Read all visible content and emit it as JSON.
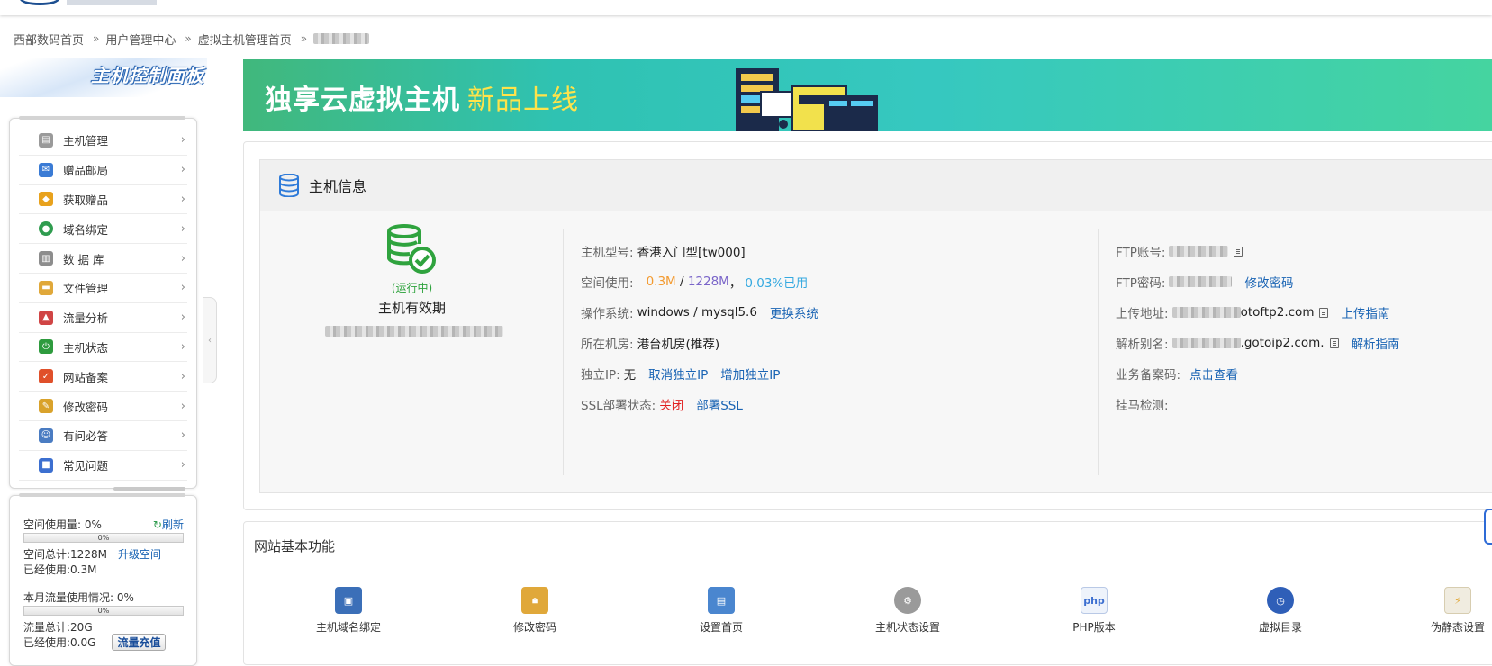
{
  "breadcrumb": {
    "items": [
      "西部数码首页",
      "用户管理中心",
      "虚拟主机管理首页"
    ],
    "separator": "»"
  },
  "sidebar": {
    "panel_title": "主机控制面板",
    "items": [
      {
        "label": "主机管理",
        "icon": "server-icon",
        "color": "#8a8a8a"
      },
      {
        "label": "赠品邮局",
        "icon": "mail-icon",
        "color": "#3a7bd5"
      },
      {
        "label": "获取赠品",
        "icon": "gift-icon",
        "color": "#e8a21d"
      },
      {
        "label": "域名绑定",
        "icon": "globe-icon",
        "color": "#2f9c4f"
      },
      {
        "label": "数 据 库",
        "icon": "database-icon",
        "color": "#7d7d7d"
      },
      {
        "label": "文件管理",
        "icon": "folder-icon",
        "color": "#e0a83a"
      },
      {
        "label": "流量分析",
        "icon": "chart-icon",
        "color": "#d04545"
      },
      {
        "label": "主机状态",
        "icon": "power-icon",
        "color": "#2e9b3e"
      },
      {
        "label": "网站备案",
        "icon": "record-icon",
        "color": "#e0502a"
      },
      {
        "label": "修改密码",
        "icon": "key-icon",
        "color": "#d9a22b"
      },
      {
        "label": "有问必答",
        "icon": "support-icon",
        "color": "#4a7cc2"
      },
      {
        "label": "常见问题",
        "icon": "faq-icon",
        "color": "#3c6fd0"
      }
    ],
    "chevron": "›"
  },
  "usage": {
    "space_used_label": "空间使用量: 0%",
    "refresh": "刷新",
    "space_bar_text": "0%",
    "space_total": "空间总计:1228M",
    "upgrade": "升级空间",
    "space_used": "已经使用:0.3M",
    "traffic_label": "本月流量使用情况: 0%",
    "traffic_bar_text": "0%",
    "traffic_total": "流量总计:20G",
    "traffic_used": "已经使用:0.0G",
    "recharge": "流量充值",
    "space_percent": 0,
    "traffic_percent": 0
  },
  "banner": {
    "title": "独享云虚拟主机",
    "subtitle": "新品上线"
  },
  "info": {
    "title": "主机信息",
    "status": "(运行中)",
    "validity_label": "主机有效期",
    "model_label": "主机型号:",
    "model_value": "香港入门型[tw000]",
    "space_label": "空间使用:",
    "space_used": "0.3M",
    "space_sep": " / ",
    "space_total": "1228M",
    "space_comma": "，",
    "space_percent": "0.03%已用",
    "os_label": "操作系统:",
    "os_value": "windows / mysql5.6",
    "os_link": "更换系统",
    "room_label": "所在机房:",
    "room_value": "港台机房(推荐)",
    "ip_label": "独立IP:",
    "ip_value": "无",
    "ip_cancel": "取消独立IP",
    "ip_add": "增加独立IP",
    "ssl_label": "SSL部署状态:",
    "ssl_value": "关闭",
    "ssl_link": "部署SSL",
    "ftp_account_label": "FTP账号:",
    "ftp_pass_label": "FTP密码:",
    "ftp_pass_link": "修改密码",
    "upload_label": "上传地址:",
    "upload_suffix": "otoftp2.com",
    "upload_link": "上传指南",
    "alias_label": "解析别名:",
    "alias_suffix": ".gotoip2.com.",
    "alias_link": "解析指南",
    "icp_label": "业务备案码:",
    "icp_link": "点击查看",
    "malware_label": "挂马检测:"
  },
  "functions": {
    "title": "网站基本功能",
    "items": [
      {
        "label": "主机域名绑定",
        "icon": "domain-bind-icon"
      },
      {
        "label": "修改密码",
        "icon": "lock-icon"
      },
      {
        "label": "设置首页",
        "icon": "homepage-icon"
      },
      {
        "label": "主机状态设置",
        "icon": "settings-gear-icon"
      },
      {
        "label": "PHP版本",
        "icon": "php-icon"
      },
      {
        "label": "虚拟目录",
        "icon": "clock-icon"
      },
      {
        "label": "伪静态设置",
        "icon": "rewrite-icon"
      }
    ]
  },
  "colors": {
    "link": "#1a64b4",
    "running": "#2fa33e",
    "space_used": "#f39a2f",
    "space_total": "#7a65c9",
    "space_percent": "#35a9e0",
    "ssl_off": "#e02020",
    "banner_subtitle": "#ffe34a"
  }
}
